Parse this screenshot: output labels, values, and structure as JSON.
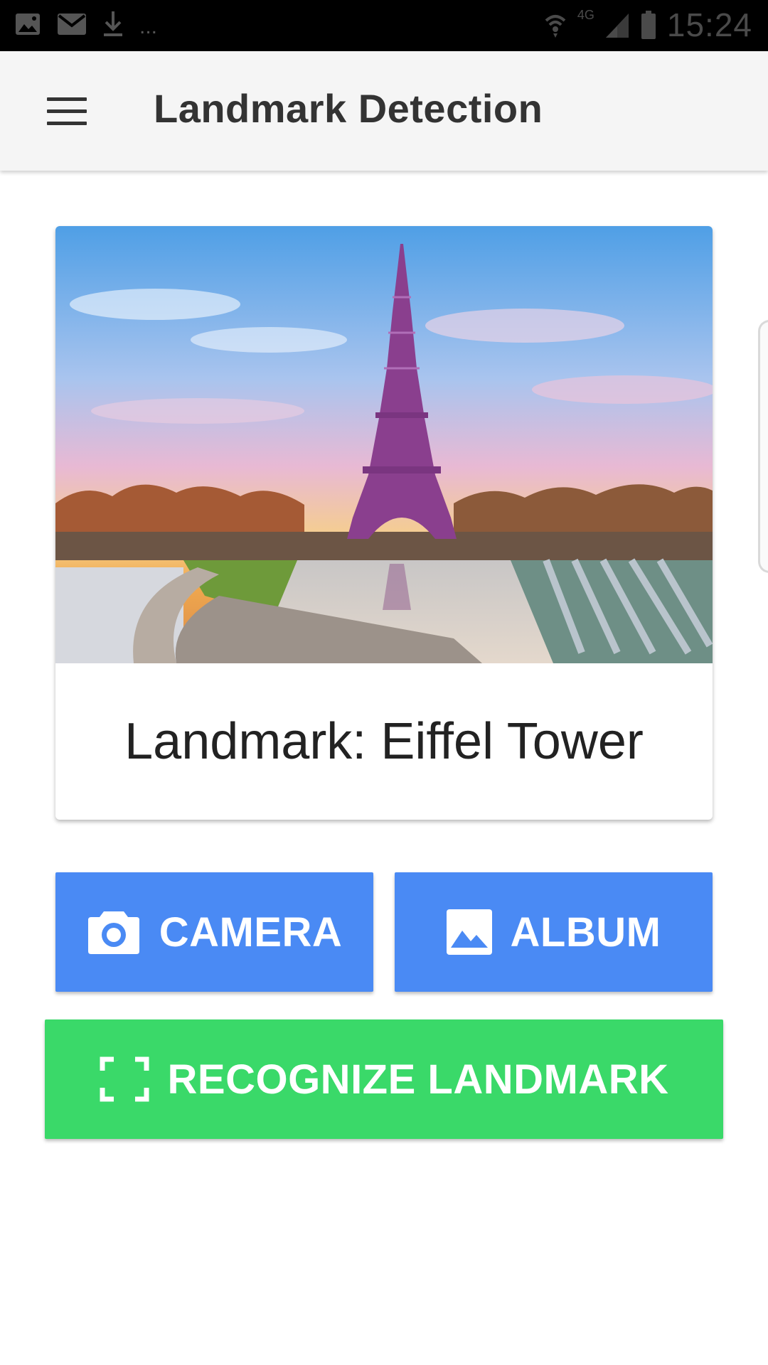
{
  "status_bar": {
    "time": "15:24",
    "network": "4G",
    "overflow": "...",
    "left_icons": [
      "image-icon",
      "mail-icon",
      "download-icon"
    ],
    "right_icons": [
      "wifi-icon",
      "signal-icon",
      "battery-icon"
    ]
  },
  "app_bar": {
    "title": "Landmark Detection",
    "menu_icon": "hamburger-menu-icon"
  },
  "card": {
    "image_subject": "Eiffel Tower at sunset",
    "result_text": "Landmark: Eiffel Tower"
  },
  "buttons": {
    "camera": {
      "label": "CAMERA",
      "icon": "camera-icon"
    },
    "album": {
      "label": "ALBUM",
      "icon": "image-icon"
    },
    "recognize": {
      "label": "RECOGNIZE LANDMARK",
      "icon": "scan-frame-icon"
    }
  },
  "colors": {
    "primary_button": "#4a8af4",
    "recognize_button": "#3ad969",
    "app_bar": "#f5f5f5",
    "status_bar": "#000000"
  }
}
